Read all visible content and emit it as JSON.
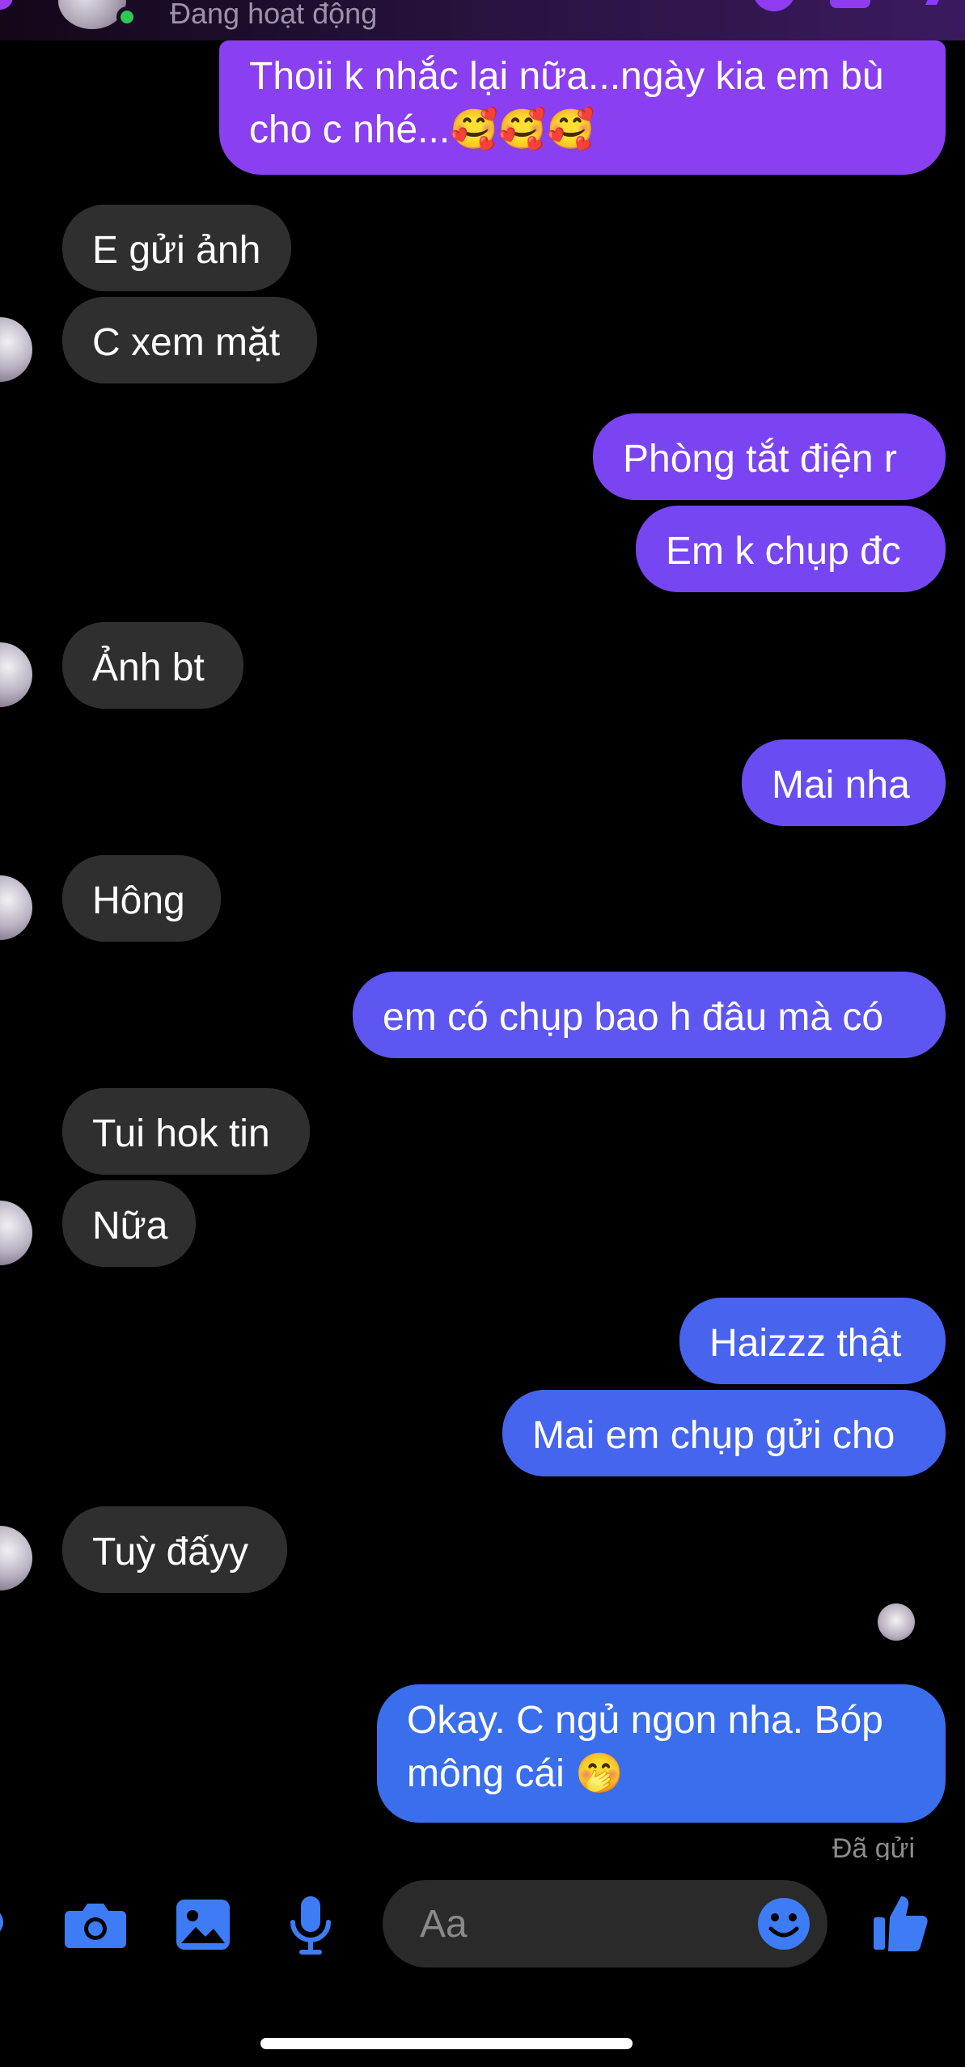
{
  "header": {
    "status_text": "Đang hoạt động"
  },
  "messages": [
    {
      "id": 1,
      "dir": "sent",
      "lines": [
        "Thoii k nhắc lại nữa...ngày kia em bù",
        "cho c nhé...🥰🥰🥰"
      ],
      "color": "#8a3ff1"
    },
    {
      "id": 2,
      "dir": "recv",
      "lines": [
        "E gửi ảnh"
      ]
    },
    {
      "id": 3,
      "dir": "recv",
      "lines": [
        "C xem mặt"
      ]
    },
    {
      "id": 4,
      "dir": "sent",
      "lines": [
        "Phòng tắt điện r"
      ],
      "color": "#7b44f2"
    },
    {
      "id": 5,
      "dir": "sent",
      "lines": [
        "Em k chụp đc"
      ],
      "color": "#7546f2"
    },
    {
      "id": 6,
      "dir": "recv",
      "lines": [
        "Ảnh bt"
      ]
    },
    {
      "id": 7,
      "dir": "sent",
      "lines": [
        "Mai nha"
      ],
      "color": "#6a4df2"
    },
    {
      "id": 8,
      "dir": "recv",
      "lines": [
        "Hông"
      ]
    },
    {
      "id": 9,
      "dir": "sent",
      "lines": [
        "em có chụp bao h đâu mà có"
      ],
      "color": "#5e56f0"
    },
    {
      "id": 10,
      "dir": "recv",
      "lines": [
        "Tui hok tin"
      ]
    },
    {
      "id": 11,
      "dir": "recv",
      "lines": [
        "Nữa"
      ]
    },
    {
      "id": 12,
      "dir": "sent",
      "lines": [
        "Haizzz thật"
      ],
      "color": "#4863ee"
    },
    {
      "id": 13,
      "dir": "sent",
      "lines": [
        "Mai em chụp gửi cho"
      ],
      "color": "#4565ee"
    },
    {
      "id": 14,
      "dir": "recv",
      "lines": [
        "Tuỳ đấyy"
      ]
    },
    {
      "id": 15,
      "dir": "sent",
      "lines": [
        "Okay. C ngủ ngon nha. Bóp",
        "mông cái 🤭"
      ],
      "color": "#3a6eec"
    }
  ],
  "sent_status": "Đã gửi",
  "composer": {
    "placeholder": "Aa",
    "icons": [
      "more-icon",
      "camera-icon",
      "photo-icon",
      "microphone-icon",
      "emoji-icon",
      "like-icon"
    ],
    "accent": "#3d7cf5"
  }
}
